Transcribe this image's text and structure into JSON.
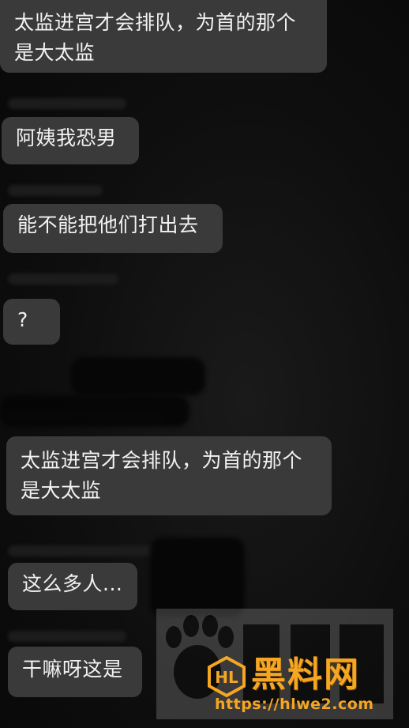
{
  "messages": [
    {
      "text": "太监进宫才会排队，为首的那个\n是大太监"
    },
    {
      "text": "阿姨我恐男"
    },
    {
      "text": "能不能把他们打出去"
    },
    {
      "text": "?"
    },
    {
      "text": "太监进宫才会排队，为首的那个\n是大太监"
    },
    {
      "text": "这么多人..."
    },
    {
      "text": "干嘛呀这是"
    }
  ],
  "watermark": {
    "name": "黑料网",
    "url": "https://hlwe2.com",
    "accent_color": "#f5a623"
  },
  "colors": {
    "background": "#0e0e0e",
    "bubble": "#3a3a3a",
    "text": "#f2f2f2"
  }
}
